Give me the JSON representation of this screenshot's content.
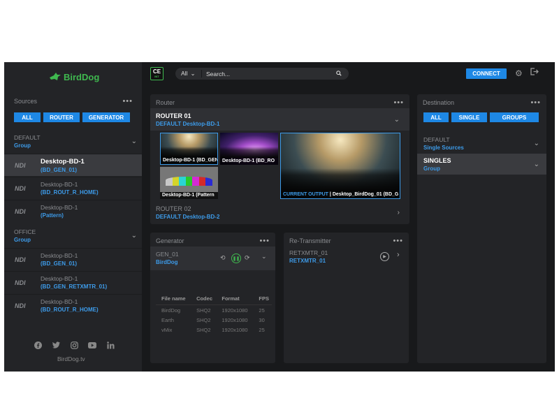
{
  "brand": {
    "name": "BirdDog",
    "site": "BirdDog.tv",
    "accent": "#1e88e5",
    "green": "#3fb84f"
  },
  "topbar": {
    "app_badge": "CE",
    "app_badge_sub": "INT",
    "search_scope": "All",
    "search_placeholder": "Search...",
    "connect_label": "CONNECT",
    "icons": [
      "search-icon",
      "gear-icon",
      "logout-icon"
    ]
  },
  "sources": {
    "title": "Sources",
    "tabs": [
      "ALL",
      "ROUTER",
      "GENERATOR"
    ],
    "groups": [
      {
        "name": "DEFAULT",
        "type": "Group",
        "items": [
          {
            "badge": "NDI",
            "name": "Desktop-BD-1",
            "sub": "(BD_GEN_01)",
            "selected": true
          },
          {
            "badge": "NDI",
            "name": "Desktop-BD-1",
            "sub": "(BD_ROUT_R_HOME)",
            "selected": false
          },
          {
            "badge": "NDI",
            "name": "Desktop-BD-1",
            "sub": "(Pattern)",
            "selected": false
          }
        ]
      },
      {
        "name": "OFFICE",
        "type": "Group",
        "items": [
          {
            "badge": "NDI",
            "name": "Desktop-BD-1",
            "sub": "(BD_GEN_01)",
            "selected": false
          },
          {
            "badge": "NDI",
            "name": "Desktop-BD-1",
            "sub": "(BD_GEN_RETXMTR_01)",
            "selected": false
          },
          {
            "badge": "NDI",
            "name": "Desktop-BD-1",
            "sub": "(BD_ROUT_R_HOME)",
            "selected": false
          }
        ]
      }
    ],
    "social_icons": [
      "facebook-icon",
      "twitter-icon",
      "instagram-icon",
      "youtube-icon",
      "linkedin-icon"
    ]
  },
  "router": {
    "title": "Router",
    "routers": [
      {
        "name": "ROUTER 01",
        "sub": "DEFAULT Desktop-BD-1",
        "expanded": true
      },
      {
        "name": "ROUTER 02",
        "sub": "DEFAULT Desktop-BD-2",
        "expanded": false
      }
    ],
    "thumbnails": [
      {
        "label": "Desktop-BD-1 (BD_GEN",
        "selected": true
      },
      {
        "label": "Desktop-BD-1 (BD_RO",
        "selected": false
      },
      {
        "label": "Desktop-BD-1 (Pattern",
        "selected": false
      }
    ],
    "output": {
      "current_label": "CURRENT OUTPUT",
      "separator": "|",
      "source": "Desktop_BirdDog_01 (BD_G"
    }
  },
  "generator": {
    "title": "Generator",
    "name": "GEN_01",
    "sub": "BirdDog",
    "columns": [
      "File name",
      "Codec",
      "Format",
      "FPS"
    ],
    "rows": [
      [
        "BirdDog",
        "SHQ2",
        "1920x1080",
        "25"
      ],
      [
        "Earth",
        "SHQ2",
        "1920x1080",
        "30"
      ],
      [
        "vMix",
        "SHQ2",
        "1920x1080",
        "25"
      ]
    ]
  },
  "retransmitter": {
    "title": "Re-Transmitter",
    "name": "RETXMTR_01",
    "sub": "RETXMTR_01"
  },
  "destination": {
    "title": "Destination",
    "tabs": [
      "ALL",
      "SINGLE",
      "GROUPS"
    ],
    "rows": [
      {
        "name": "DEFAULT",
        "sub": "Single Sources",
        "selected": false
      },
      {
        "name": "SINGLES",
        "sub": "Group",
        "selected": true
      }
    ]
  }
}
